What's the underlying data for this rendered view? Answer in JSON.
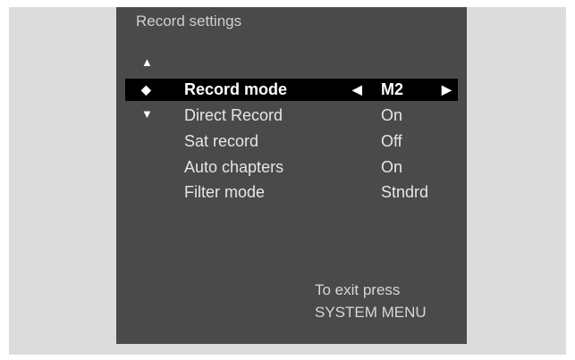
{
  "menu": {
    "title": "Record settings",
    "selected": {
      "label": "Record mode",
      "value": "M2"
    },
    "items": [
      {
        "label": "Direct Record",
        "value": "On"
      },
      {
        "label": "Sat record",
        "value": "Off"
      },
      {
        "label": "Auto chapters",
        "value": "On"
      },
      {
        "label": "Filter mode",
        "value": "Stndrd"
      }
    ],
    "exit_line1": "To exit press",
    "exit_line2": "SYSTEM MENU"
  },
  "icons": {
    "up": "triangle-up-icon",
    "down": "triangle-down-icon",
    "updown": "diamond-arrows-icon",
    "left": "triangle-left-icon",
    "right": "triangle-right-icon"
  },
  "colors": {
    "menu_bg": "#4a4a4a",
    "selected_bg": "#000000",
    "frame_bg": "#dcdcdc"
  }
}
